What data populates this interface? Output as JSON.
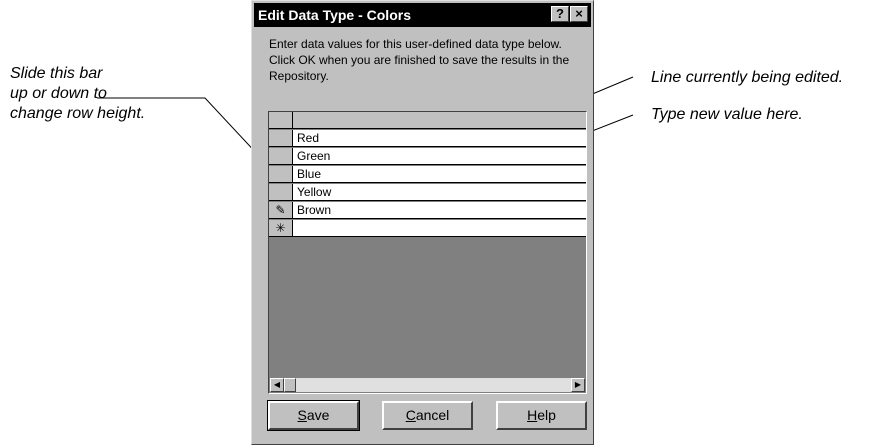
{
  "callouts": {
    "left": [
      "Slide this bar",
      "up or down to",
      "change row height."
    ],
    "line_edited": "Line currently being edited.",
    "type_new": "Type new value here."
  },
  "dialog": {
    "title": "Edit Data Type - Colors",
    "help_glyph": "?",
    "close_glyph": "×",
    "instructions": "Enter data values for this user-defined data type below.  Click OK when you are finished to save the results in the Repository.",
    "rows": [
      {
        "marker": "",
        "value": "Red"
      },
      {
        "marker": "",
        "value": "Green"
      },
      {
        "marker": "",
        "value": "Blue"
      },
      {
        "marker": "",
        "value": "Yellow"
      },
      {
        "marker": "✎",
        "value": "Brown"
      },
      {
        "marker": "✳",
        "value": ""
      }
    ],
    "scroll_left": "◀",
    "scroll_right": "▶",
    "buttons": {
      "save": {
        "mnemonic": "S",
        "rest": "ave"
      },
      "cancel": {
        "mnemonic": "C",
        "rest": "ancel"
      },
      "help": {
        "mnemonic": "H",
        "rest": "elp"
      }
    }
  }
}
